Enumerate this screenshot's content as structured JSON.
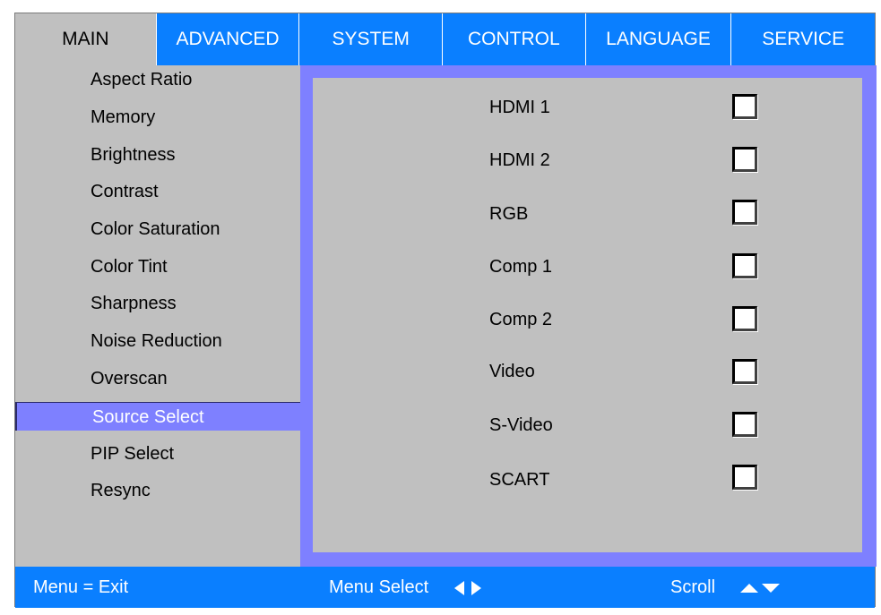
{
  "tabs": [
    {
      "label": "MAIN",
      "active": true
    },
    {
      "label": "ADVANCED",
      "active": false
    },
    {
      "label": "SYSTEM",
      "active": false
    },
    {
      "label": "CONTROL",
      "active": false
    },
    {
      "label": "LANGUAGE",
      "active": false
    },
    {
      "label": "SERVICE",
      "active": false
    }
  ],
  "menu": {
    "items": [
      "Aspect Ratio",
      "Memory",
      "Brightness",
      "Contrast",
      "Color Saturation",
      "Color Tint",
      "Sharpness",
      "Noise Reduction",
      "Overscan",
      "Source Select",
      "PIP Select",
      "Resync"
    ],
    "selected": "Source Select"
  },
  "sources": {
    "items": [
      {
        "label": "HDMI 1",
        "checked": false
      },
      {
        "label": "HDMI 2",
        "checked": false
      },
      {
        "label": "RGB",
        "checked": false
      },
      {
        "label": "Comp 1",
        "checked": false
      },
      {
        "label": "Comp 2",
        "checked": false
      },
      {
        "label": "Video",
        "checked": false
      },
      {
        "label": "S-Video",
        "checked": false
      },
      {
        "label": "SCART",
        "checked": false
      }
    ]
  },
  "footer": {
    "exit": "Menu = Exit",
    "select": "Menu Select",
    "scroll": "Scroll",
    "select_icon": "left-right-arrows-icon",
    "scroll_icon": "up-down-arrows-icon"
  },
  "colors": {
    "accent": "#0a7fff",
    "highlight": "#7e80ff",
    "panel_bg": "#c0c0c0"
  }
}
